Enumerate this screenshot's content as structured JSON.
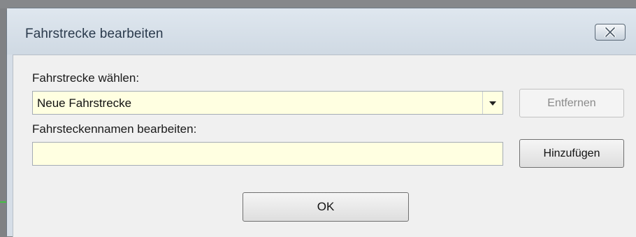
{
  "window": {
    "title": "Fahrstrecke bearbeiten"
  },
  "route_select": {
    "label": "Fahrstrecke wählen:",
    "value": "Neue Fahrstrecke"
  },
  "route_name": {
    "label": "Fahrsteckennamen bearbeiten:",
    "value": ""
  },
  "buttons": {
    "remove": "Entfernen",
    "add": "Hinzufügen",
    "ok": "OK"
  },
  "colors": {
    "input_background": "#ffffe1",
    "dialog_background": "#f0f0f0",
    "titlebar": "#d6dee7"
  },
  "icons": {
    "close": "close-icon",
    "dropdown": "chevron-down-icon"
  }
}
